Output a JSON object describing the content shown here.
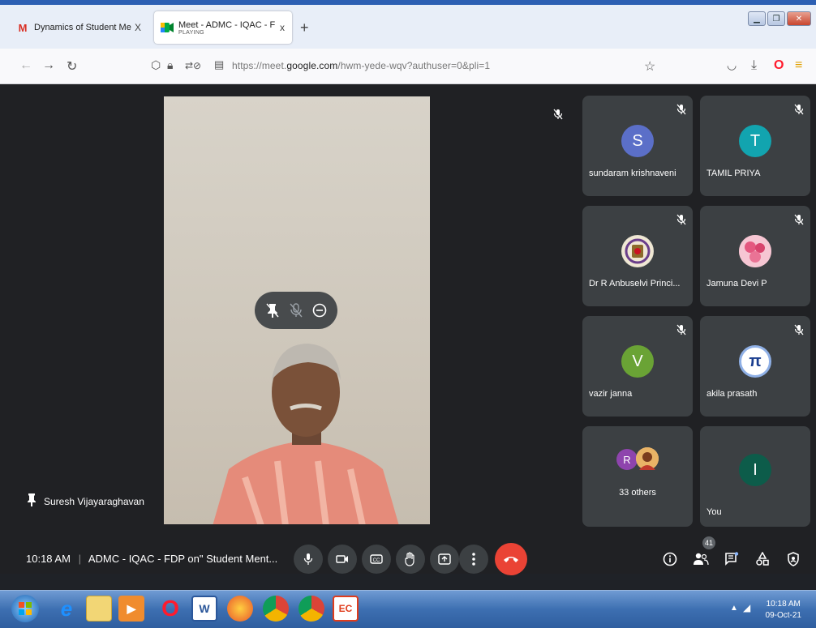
{
  "browser": {
    "tabs": [
      {
        "title": "Dynamics of Student Mentoring",
        "close": "X"
      },
      {
        "title": "Meet - ADMC - IQAC - FDP on\"",
        "subtitle": "PLAYING",
        "close": "x"
      }
    ],
    "new_tab": "+",
    "url_prefix": "https://meet.",
    "url_domain": "google.com",
    "url_suffix": "/hwm-yede-wqv?authuser=0&pli=1",
    "colors": {
      "accent": "#2c5fb3",
      "gmail_red": "#d93025",
      "opera_red": "#ff1b2d"
    }
  },
  "meet": {
    "main_speaker": "Suresh Vijayaraghavan",
    "participants": [
      {
        "name": "sundaram krishnaveni",
        "initial": "S",
        "color": "#5b6fc8"
      },
      {
        "name": "TAMIL PRIYA",
        "initial": "T",
        "color": "#12a4af"
      },
      {
        "name": "Dr R Anbuselvi Princi...",
        "initial": "",
        "color": "#e9e2d1"
      },
      {
        "name": "Jamuna Devi P",
        "initial": "",
        "color": "#f0b7c6"
      },
      {
        "name": "vazir janna",
        "initial": "V",
        "color": "#6aa335"
      },
      {
        "name": "akila prasath",
        "initial": "π",
        "color": "#ffffff"
      },
      {
        "name": "33 others",
        "initial": "R",
        "color": "#8e44ad"
      },
      {
        "name": "You",
        "initial": "I",
        "color": "#0d5c4a"
      }
    ],
    "time": "10:18 AM",
    "meeting_title": "ADMC - IQAC - FDP on\" Student Ment...",
    "people_count": "41",
    "end_call_color": "#ea4335"
  },
  "taskbar": {
    "time": "10:18 AM",
    "date": "09-Oct-21"
  }
}
